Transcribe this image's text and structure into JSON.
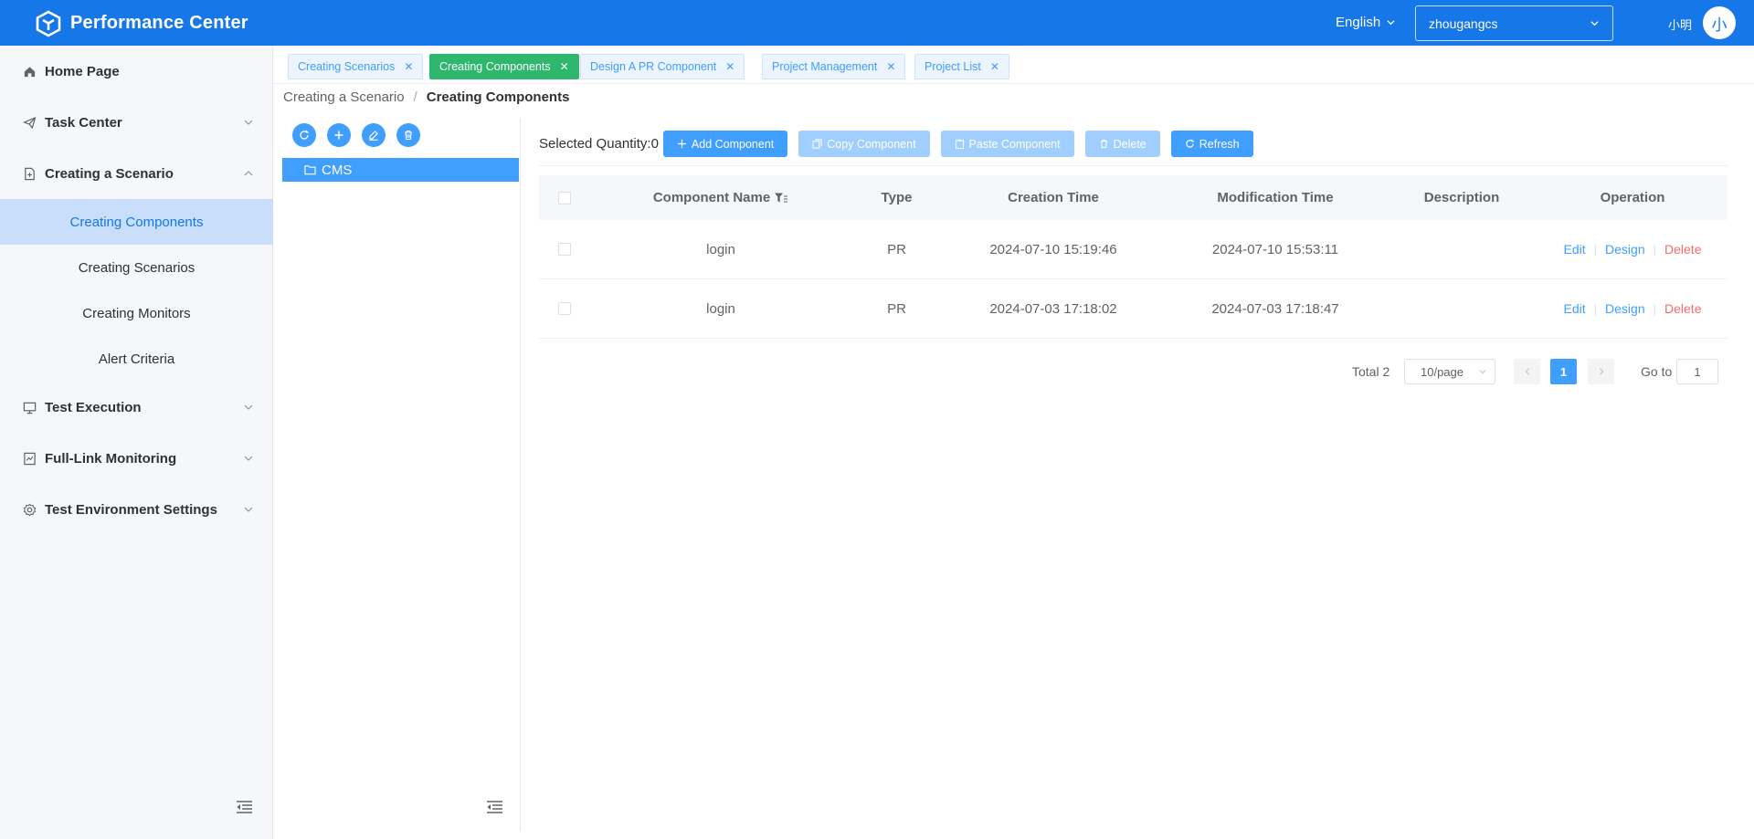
{
  "header": {
    "app_title": "Performance Center",
    "language": "English",
    "project": "zhougangcs",
    "username": "小明",
    "avatar_initial": "小",
    "brand_color": "#1677e8"
  },
  "sidebar": {
    "menu": [
      {
        "label": "Home Page",
        "icon": "home-icon"
      },
      {
        "label": "Task Center",
        "icon": "send-icon"
      },
      {
        "label": "Creating a Scenario",
        "icon": "document-add-icon"
      },
      {
        "label": "Test Execution",
        "icon": "monitor-icon"
      },
      {
        "label": "Full-Link Monitoring",
        "icon": "data-board-icon"
      },
      {
        "label": "Test Environment Settings",
        "icon": "gear-icon"
      }
    ],
    "submenu": [
      {
        "label": "Creating Components",
        "active": true
      },
      {
        "label": "Creating Scenarios"
      },
      {
        "label": "Creating Monitors"
      },
      {
        "label": "Alert Criteria"
      }
    ]
  },
  "tabs": [
    {
      "label": "Creating Scenarios"
    },
    {
      "label": "Creating Components",
      "active": true
    },
    {
      "label": "Design A PR Component"
    },
    {
      "label": "Project Management"
    },
    {
      "label": "Project List"
    }
  ],
  "breadcrumb": {
    "parent": "Creating a Scenario",
    "separator": "/",
    "current": "Creating Components"
  },
  "tree": {
    "root_label": "CMS"
  },
  "toolbar": {
    "selected_label": "Selected Quantity:",
    "selected_count": "0",
    "add": "Add Component",
    "copy": "Copy Component",
    "paste": "Paste Component",
    "delete": "Delete",
    "refresh": "Refresh"
  },
  "table": {
    "columns": [
      "Component Name",
      "Type",
      "Creation Time",
      "Modification Time",
      "Description",
      "Operation"
    ],
    "rows": [
      {
        "name": "login",
        "type": "PR",
        "created": "2024-07-10 15:19:46",
        "modified": "2024-07-10 15:53:11",
        "description": ""
      },
      {
        "name": "login",
        "type": "PR",
        "created": "2024-07-03 17:18:02",
        "modified": "2024-07-03 17:18:47",
        "description": ""
      }
    ],
    "ops": {
      "edit": "Edit",
      "design": "Design",
      "delete": "Delete"
    }
  },
  "pagination": {
    "total_label": "Total 2",
    "page_size": "10/page",
    "current_page": "1",
    "goto_label": "Go to",
    "goto_value": "1"
  }
}
